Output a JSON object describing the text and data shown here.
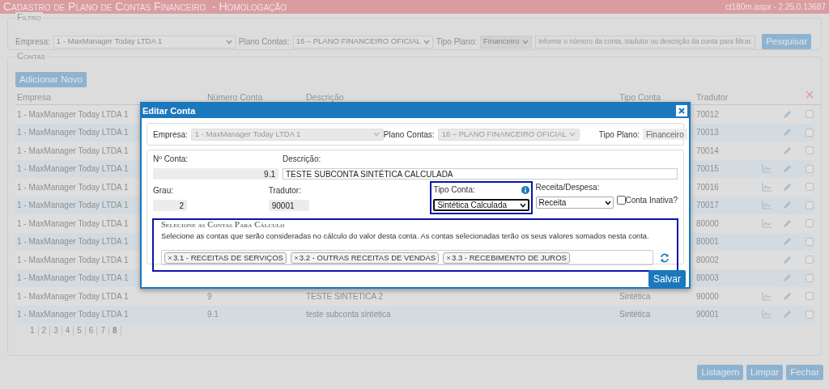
{
  "header": {
    "title": "Cadastro de Plano de Contas Financeiro  - Homologação",
    "version": "ct180m.aspx - 2.25.0.13687"
  },
  "filter": {
    "legend": "Filtro",
    "empresa_label": "Empresa:",
    "empresa_value": "1 - MaxManager Today LTDA 1",
    "plano_label": "Plano Contas:",
    "plano_value": "16 – PLANO FINANCEIRO OFICIAL",
    "tipo_label": "Tipo Plano:",
    "tipo_value": "Financeiro",
    "tipo_disabled": true,
    "search_placeholder": "Informe o número da conta, tradutor ou descrição da conta para filtrar.",
    "search_button": "Pesquisar"
  },
  "contas": {
    "legend": "Contas",
    "add_button": "Adicionar Novo",
    "columns": [
      "Empresa",
      "Número Conta",
      "Descrição",
      "Tipo Conta",
      "Tradutor"
    ],
    "rows": [
      {
        "empresa": "1 - MaxManager Today LTDA 1",
        "tradutor": "70012",
        "chart": false,
        "checked": false
      },
      {
        "empresa": "1 - MaxManager Today LTDA 1",
        "tradutor": "70013",
        "chart": false,
        "checked": false
      },
      {
        "empresa": "1 - MaxManager Today LTDA 1",
        "tradutor": "70014",
        "chart": false,
        "checked": false
      },
      {
        "empresa": "1 - MaxManager Today LTDA 1",
        "tradutor": "70015",
        "chart": true,
        "checked": false
      },
      {
        "empresa": "1 - MaxManager Today LTDA 1",
        "tradutor": "70016",
        "chart": true,
        "checked": false
      },
      {
        "empresa": "1 - MaxManager Today LTDA 1",
        "tradutor": "70017",
        "chart": true,
        "checked": false
      },
      {
        "empresa": "1 - MaxManager Today LTDA 1",
        "tradutor": "80000",
        "chart": true,
        "checked": false
      },
      {
        "empresa": "1 - MaxManager Today LTDA 1",
        "tradutor": "80001",
        "chart": false,
        "checked": false
      },
      {
        "empresa": "1 - MaxManager Today LTDA 1",
        "tradutor": "80002",
        "chart": false,
        "checked": false
      },
      {
        "empresa": "1 - MaxManager Today LTDA 1",
        "tradutor": "80003",
        "chart": false,
        "checked": false
      },
      {
        "empresa": "1 - MaxManager Today LTDA 1",
        "numero": "9",
        "descricao": "TESTE SINTETICA 2",
        "tipo": "Sintética",
        "tradutor": "90000",
        "chart": true,
        "checked": false
      },
      {
        "empresa": "1 - MaxManager Today LTDA 1",
        "numero": "9.1",
        "descricao": "teste subconta sintetica",
        "tipo": "Sintética",
        "tradutor": "90001",
        "chart": true,
        "checked": false
      }
    ],
    "pages": [
      {
        "label": "1",
        "selected": false
      },
      {
        "label": "2",
        "selected": false
      },
      {
        "label": "3",
        "selected": false
      },
      {
        "label": "4",
        "selected": false
      },
      {
        "label": "5",
        "selected": false
      },
      {
        "label": "6",
        "selected": false
      },
      {
        "label": "7",
        "selected": false
      },
      {
        "label": "8",
        "selected": true
      }
    ]
  },
  "footer_buttons": [
    "Listagem",
    "Limpar",
    "Fechar"
  ],
  "modal": {
    "title": "Editar Conta",
    "empresa_label": "Empresa:",
    "empresa_value": "1 - MaxManager Today LTDA 1",
    "plano_label": "Plano Contas:",
    "plano_value": "16 – PLANO FINANCEIRO OFICIAL",
    "tipo_plano_label": "Tipo Plano:",
    "tipo_plano_value": "Financeiro",
    "numero_label": "Nº Conta:",
    "numero_value": "9.1",
    "descricao_label": "Descrição:",
    "descricao_value": "TESTE SUBCONTA SINTÉTICA CALCULADA",
    "grau_label": "Grau:",
    "grau_value": "2",
    "tradutor_label": "Tradutor:",
    "tradutor_value": "90001",
    "tipo_conta_label": "Tipo Conta:",
    "tipo_conta_value": "Sintética Calculada",
    "tipo_conta_highlighted": true,
    "receita_label": "Receita/Despesa:",
    "receita_value": "Receita",
    "inativa_label": "Conta Inativa?",
    "inativa_checked": false,
    "calc_legend": "Selecione as Contas Para Cálculo",
    "calc_highlighted": true,
    "calc_text": "Selecione as contas que serão consideradas no cálculo do valor desta conta. As contas selecionadas terão os seus valores somados nesta conta.",
    "tags": [
      "3.1 - RECEITAS DE SERVIÇOS",
      "3.2 - OUTRAS RECEITAS DE VENDAS",
      "3.3 - RECEBIMENTO DE JUROS"
    ],
    "save_button": "Salvar"
  }
}
